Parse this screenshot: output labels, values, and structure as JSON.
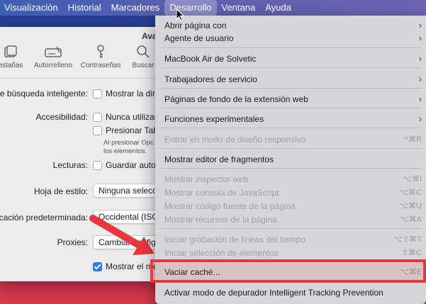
{
  "menubar": {
    "items": [
      "Visualización",
      "Historial",
      "Marcadores",
      "Desarrollo",
      "Ventana",
      "Ayuda"
    ]
  },
  "window": {
    "title_fragment": "Ava",
    "toolbar": [
      "estañas",
      "Autorrelleno",
      "Contraseñas",
      "Buscar"
    ],
    "rows": {
      "smart_search_label": "de búsqueda inteligente:",
      "smart_search_option": "Mostrar la dire",
      "accessibility_label": "Accesibilidad:",
      "accessibility_opt1": "Nunca utilizar",
      "accessibility_opt2": "Presionar Tab",
      "accessibility_note1": "Al presionar Opc",
      "accessibility_note2": "los elementos.",
      "reading_label": "Lecturas:",
      "reading_option": "Guardar autor",
      "stylesheet_label": "Hoja de estilo:",
      "stylesheet_value": "Ninguna selecci",
      "encoding_label": "icación predeterminada:",
      "encoding_value": "Occidental (ISO",
      "proxies_label": "Proxies:",
      "proxies_value": "Cambiar config",
      "show_menu_option": "Mostrar el me"
    }
  },
  "dropdown": {
    "items": [
      {
        "label": "Abrir página con",
        "submenu": true,
        "disabled": false
      },
      {
        "label": "Agente de usuario",
        "submenu": true,
        "disabled": false
      },
      {
        "label": "MacBook Air de Solvetic",
        "submenu": true,
        "disabled": false
      },
      {
        "label": "Trabajadores de servicio",
        "submenu": true,
        "disabled": false
      },
      {
        "label": "Páginas de fondo de la extensión web",
        "submenu": true,
        "disabled": false
      },
      {
        "label": "Funciones experimentales",
        "submenu": true,
        "disabled": false
      },
      {
        "label": "Entrar en modo de diseño responsivo",
        "shortcut": "^⌘R",
        "disabled": true
      },
      {
        "label": "Mostrar editor de fragmentos",
        "disabled": false
      },
      {
        "label": "Mostrar inspector web",
        "shortcut": "⌥⌘I",
        "disabled": true
      },
      {
        "label": "Mostrar consola de JavaScript",
        "shortcut": "⌥⌘C",
        "disabled": true
      },
      {
        "label": "Mostrar código fuente de la página",
        "shortcut": "⌥⌘U",
        "disabled": true
      },
      {
        "label": "Mostrar recursos de la página",
        "shortcut": "⌥⌘A",
        "disabled": true
      },
      {
        "label": "Iniciar grabación de líneas del tiempo",
        "shortcut": "⌥⇧⌘T",
        "disabled": true
      },
      {
        "label": "Iniciar selección de elementos",
        "shortcut": "⇧⌘C",
        "disabled": true
      },
      {
        "label": "Vaciar caché...",
        "shortcut": "⌥⌘E",
        "disabled": false
      },
      {
        "label": "Activar modo de depurador Intelligent Tracking Prevention",
        "disabled": false
      }
    ]
  },
  "colors": {
    "highlight": "#e8383d",
    "accent": "#2a7be4"
  }
}
